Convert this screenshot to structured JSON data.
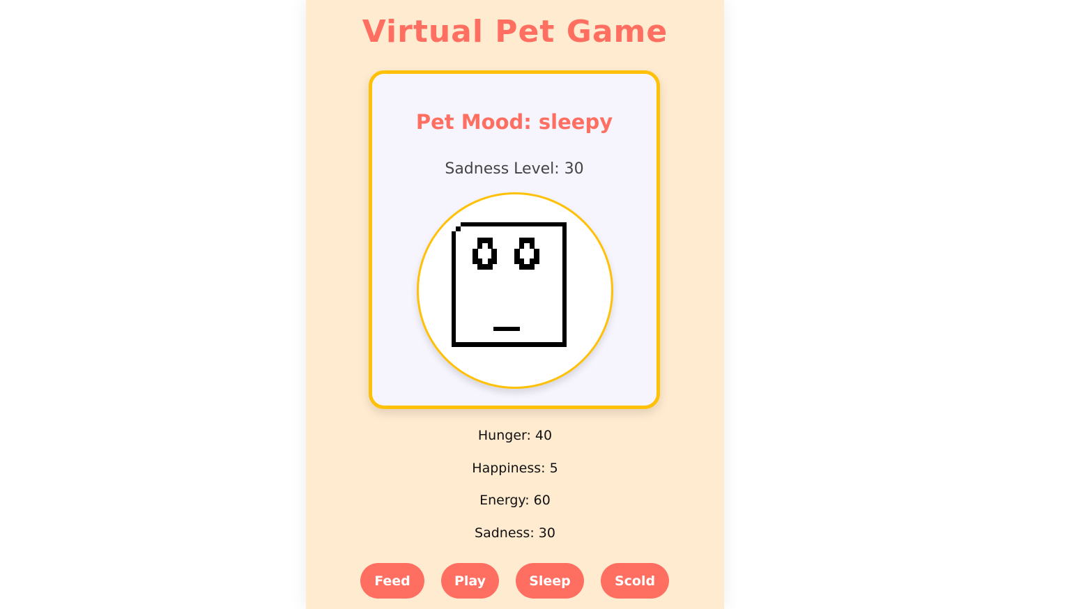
{
  "title": "Virtual Pet Game",
  "pet": {
    "mood_text": "Pet Mood: sleepy",
    "sadness_level_text": "Sadness Level: 30",
    "mood": "sleepy",
    "sadness_level": 30
  },
  "stats": [
    {
      "label": "Hunger: 40",
      "value": 40
    },
    {
      "label": "Happiness: 5",
      "value": 5
    },
    {
      "label": "Energy: 60",
      "value": 60
    },
    {
      "label": "Sadness: 30",
      "value": 30
    }
  ],
  "buttons": {
    "feed": "Feed",
    "play": "Play",
    "sleep": "Sleep",
    "scold": "Scold"
  },
  "colors": {
    "accent": "#ff6f61",
    "border": "#ffc107",
    "background": "#ffebd0",
    "card": "#f6f4fc"
  }
}
